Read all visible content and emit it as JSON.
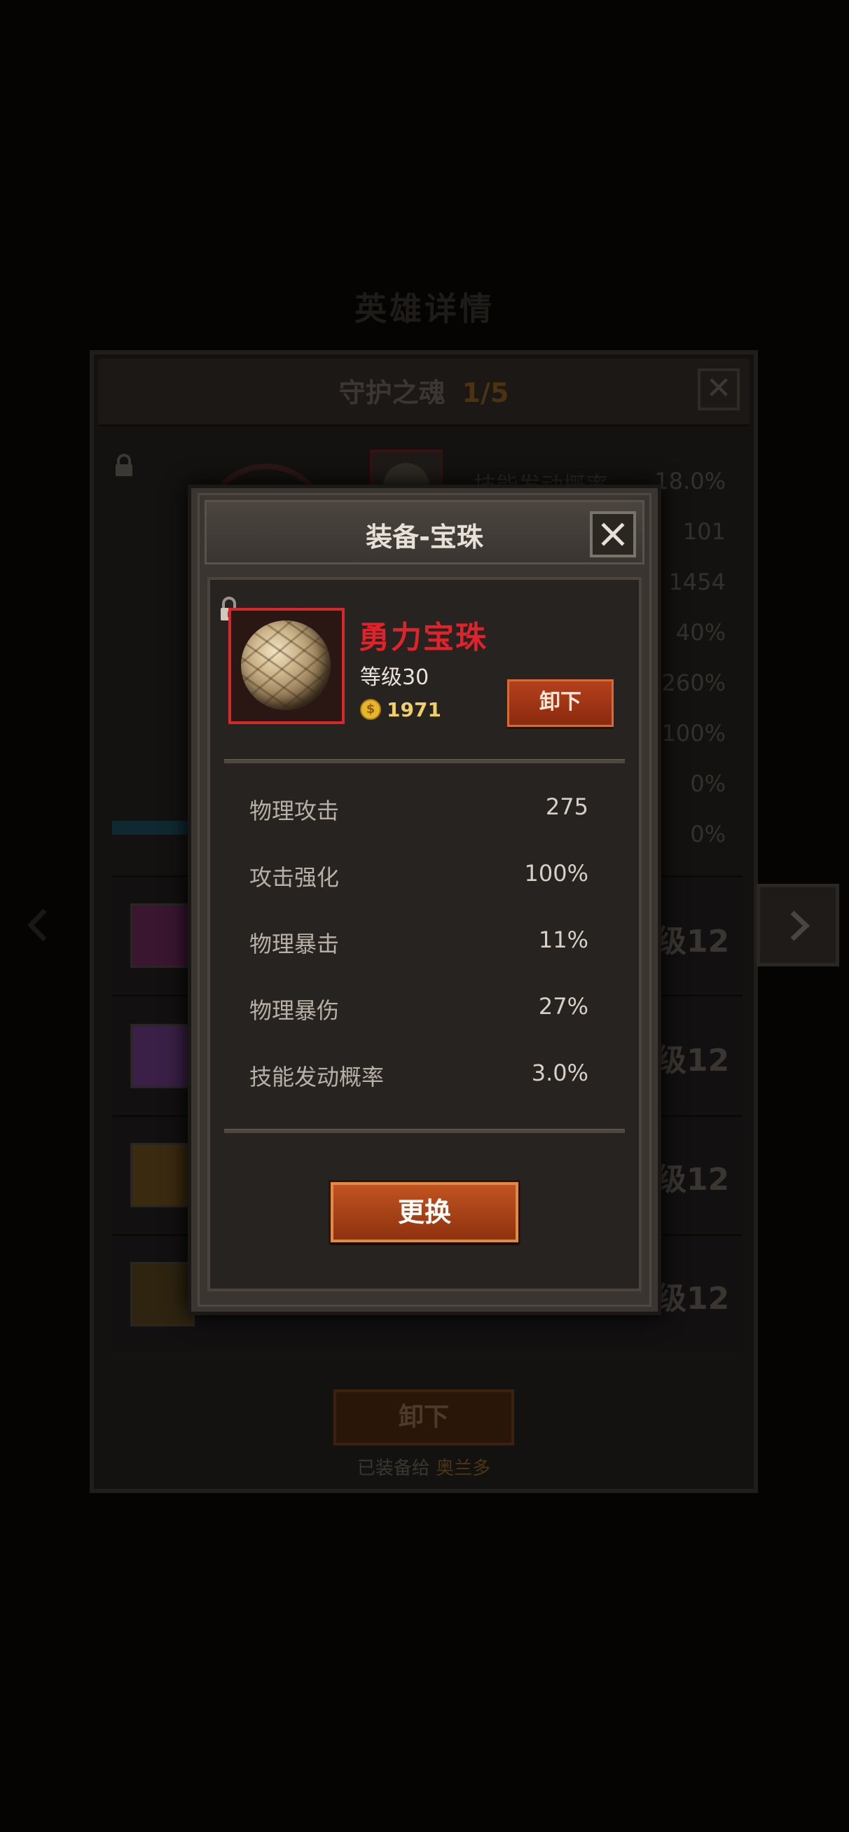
{
  "background": {
    "title": "英雄详情",
    "panel_title": "守护之魂",
    "panel_count": "1/5",
    "stats": [
      "18.0%",
      "101",
      "1454",
      "40%",
      "260%",
      "100%",
      "0%",
      "0%"
    ],
    "skill_level_suffix": "12",
    "skill_level_prefix": "级",
    "unequip_label": "卸下",
    "equipped_to_label": "已装备给",
    "equipped_to_hero": "奥兰多",
    "stat_label_first": "技能发动概率"
  },
  "modal": {
    "title": "装备-宝珠",
    "item": {
      "name": "勇力宝珠",
      "level": "等级30",
      "coin_value": "1971",
      "coin_symbol": "$"
    },
    "unequip_label": "卸下",
    "stats": [
      {
        "label": "物理攻击",
        "value": "275"
      },
      {
        "label": "攻击强化",
        "value": "100%"
      },
      {
        "label": "物理暴击",
        "value": "11%"
      },
      {
        "label": "物理暴伤",
        "value": "27%"
      },
      {
        "label": "技能发动概率",
        "value": "3.0%"
      }
    ],
    "replace_label": "更换"
  },
  "colors": {
    "item_name": "#e0222a",
    "coin": "#f0cf6a",
    "button": "#a33a16"
  },
  "icons": [
    "lock-icon",
    "close-icon",
    "coin-icon",
    "chevron-right-icon",
    "chevron-left-icon"
  ]
}
